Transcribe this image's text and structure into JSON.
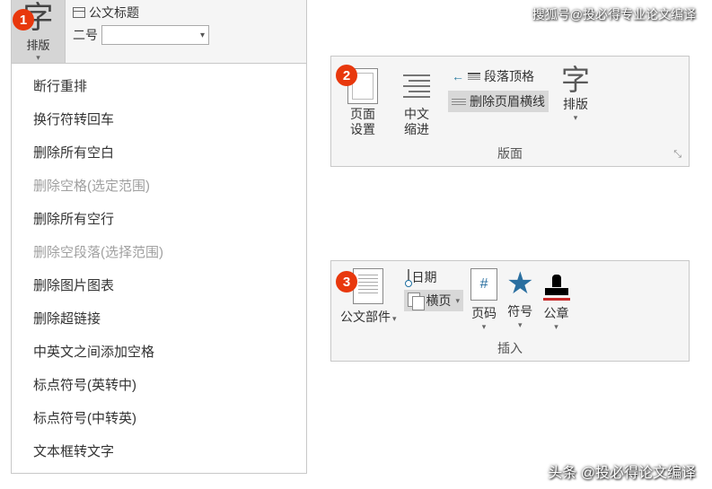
{
  "watermarks": {
    "top": "搜狐号@投必得专业论文编译",
    "bottom": "头条 @投必得论文编译"
  },
  "badges": {
    "b1": "1",
    "b2": "2",
    "b3": "3"
  },
  "panel1": {
    "zi_char": "字",
    "zi_label": "排版",
    "title_label": "公文标题",
    "size_label": "二号",
    "menu": [
      {
        "label": "断行重排",
        "enabled": true
      },
      {
        "label": "换行符转回车",
        "enabled": true
      },
      {
        "label": "删除所有空白",
        "enabled": true
      },
      {
        "label": "删除空格(选定范围)",
        "enabled": false
      },
      {
        "label": "删除所有空行",
        "enabled": true
      },
      {
        "label": "删除空段落(选择范围)",
        "enabled": false
      },
      {
        "label": "删除图片图表",
        "enabled": true
      },
      {
        "label": "删除超链接",
        "enabled": true
      },
      {
        "label": "中英文之间添加空格",
        "enabled": true
      },
      {
        "label": "标点符号(英转中)",
        "enabled": true
      },
      {
        "label": "标点符号(中转英)",
        "enabled": true
      },
      {
        "label": "文本框转文字",
        "enabled": true
      }
    ]
  },
  "panel2": {
    "page_setup": "页面\n设置",
    "cn_indent": "中文\n缩进",
    "para_top": "段落顶格",
    "del_header_line": "删除页眉横线",
    "typeset_char": "字",
    "typeset_label": "排版",
    "group": "版面"
  },
  "panel3": {
    "doc_parts": "公文部件",
    "date": "日期",
    "landscape": "横页",
    "page_num": "页码",
    "symbol": "符号",
    "stamp": "公章",
    "group": "插入"
  }
}
